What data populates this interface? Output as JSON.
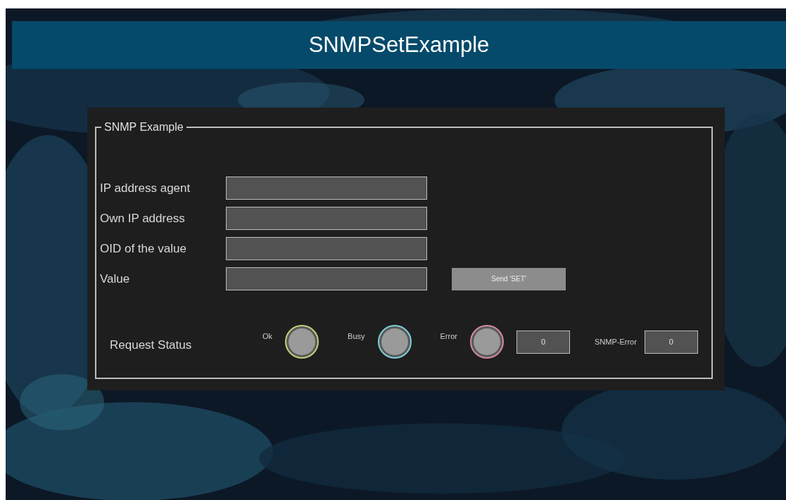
{
  "title": "SNMPSetExample",
  "group": {
    "legend": "SNMP Example",
    "fields": [
      {
        "label": "IP address agent"
      },
      {
        "label": "Own IP address"
      },
      {
        "label": "OID of the value"
      },
      {
        "label": "Value"
      }
    ],
    "send_button": "Send 'SET'",
    "status": {
      "label": "Request Status",
      "lamps": [
        {
          "label": "Ok",
          "color": "#c8cf7a",
          "on": false
        },
        {
          "label": "Busy",
          "color": "#7fd0dc",
          "on": false
        },
        {
          "label": "Error",
          "color": "#d48aa0",
          "on": false
        }
      ],
      "error_code": "0",
      "snmp_error": {
        "label": "SNMP-Error",
        "value": "0"
      }
    }
  }
}
